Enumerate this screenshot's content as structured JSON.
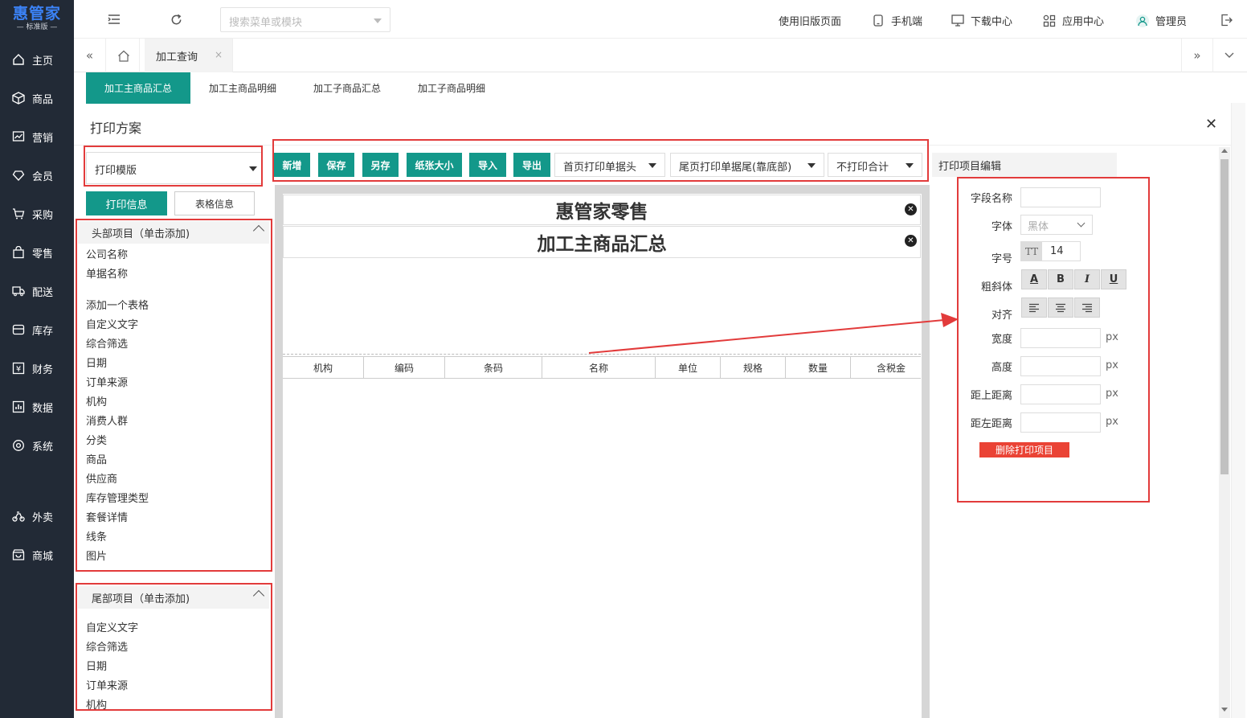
{
  "logo": {
    "brand": "惠管家",
    "edition": "— 标准版 —"
  },
  "sidebar": {
    "items": [
      {
        "label": "主页",
        "icon": "home-icon"
      },
      {
        "label": "商品",
        "icon": "box-icon"
      },
      {
        "label": "营销",
        "icon": "chart-icon"
      },
      {
        "label": "会员",
        "icon": "diamond-icon"
      },
      {
        "label": "采购",
        "icon": "cart-icon"
      },
      {
        "label": "零售",
        "icon": "bag-icon"
      },
      {
        "label": "配送",
        "icon": "truck-icon"
      },
      {
        "label": "库存",
        "icon": "warehouse-icon"
      },
      {
        "label": "财务",
        "icon": "money-icon"
      },
      {
        "label": "数据",
        "icon": "data-icon"
      },
      {
        "label": "系统",
        "icon": "settings-icon"
      },
      {
        "label": "外卖",
        "icon": "bike-icon"
      },
      {
        "label": "商城",
        "icon": "store-icon"
      }
    ]
  },
  "topbar": {
    "search_placeholder": "搜索菜单或模块",
    "links": [
      "使用旧版页面",
      "手机端",
      "下载中心",
      "应用中心",
      "管理员"
    ]
  },
  "tabbar": {
    "current_tab": "加工查询",
    "close": "×"
  },
  "subtabs": [
    "加工主商品汇总",
    "加工主商品明细",
    "加工子商品汇总",
    "加工子商品明细"
  ],
  "dialog": {
    "title": "打印方案",
    "close": "✕"
  },
  "left_panel": {
    "template_select": "打印模版",
    "print_info_btn": "打印信息",
    "table_info_btn": "表格信息",
    "header_group": "头部项目（单击添加)",
    "header_items": [
      "公司名称",
      "单据名称",
      "添加一个表格",
      "自定义文字",
      "综合筛选",
      "日期",
      "订单来源",
      "机构",
      "消费人群",
      "分类",
      "商品",
      "供应商",
      "库存管理类型",
      "套餐详情",
      "线条",
      "图片"
    ],
    "footer_group": "尾部项目（单击添加)",
    "footer_items": [
      "自定义文字",
      "综合筛选",
      "日期",
      "订单来源",
      "机构"
    ]
  },
  "toolbar": {
    "buttons": [
      "新增",
      "保存",
      "另存",
      "纸张大小",
      "导入",
      "导出"
    ],
    "dropdowns": [
      "首页打印单据头",
      "尾页打印单据尾(靠底部)",
      "不打印合计"
    ]
  },
  "canvas": {
    "titles": [
      "惠管家零售",
      "加工主商品汇总"
    ],
    "columns": [
      "机构",
      "编码",
      "条码",
      "名称",
      "单位",
      "规格",
      "数量",
      "含税金"
    ]
  },
  "right_panel": {
    "tab": "打印项目编辑",
    "field_name_label": "字段名称",
    "font_label": "字体",
    "font_value": "黑体",
    "size_label": "字号",
    "size_value": "14",
    "size_icon": "TT",
    "style_label": "粗斜体",
    "style_buttons": [
      "A",
      "B",
      "I",
      "U"
    ],
    "align_label": "对齐",
    "width_label": "宽度",
    "height_label": "高度",
    "top_label": "距上距离",
    "left_label": "距左距离",
    "unit": "px",
    "delete_btn": "删除打印项目"
  }
}
